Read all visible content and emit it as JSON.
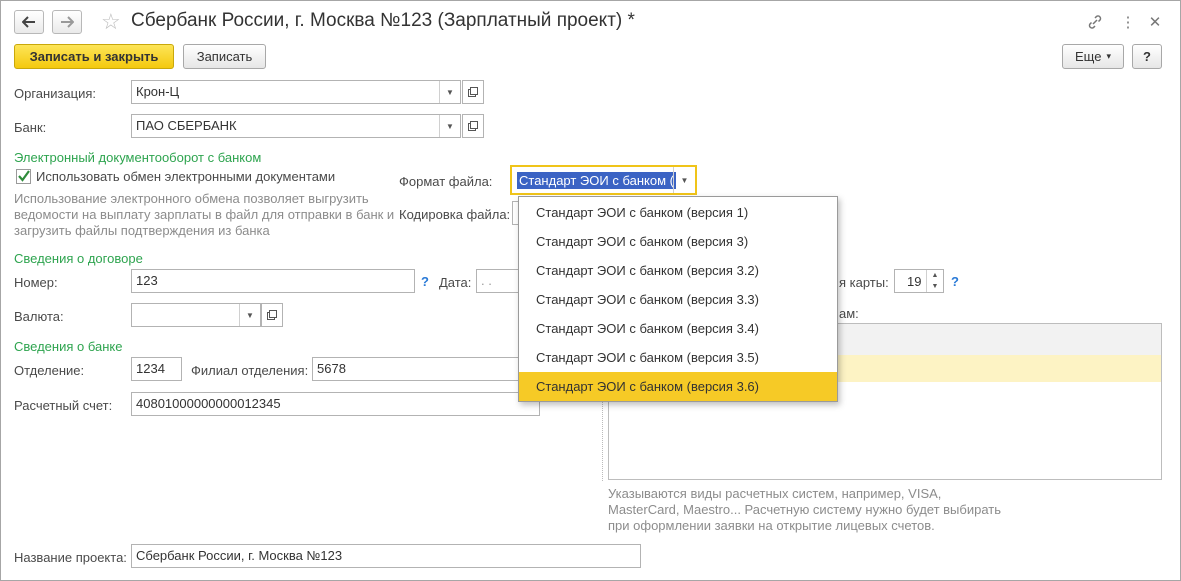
{
  "window": {
    "title": "Сбербанк России, г. Москва №123 (Зарплатный проект) *"
  },
  "toolbar": {
    "save_close": "Записать и закрыть",
    "save": "Записать",
    "more": "Еще",
    "more_arrow": "▾",
    "help": "?"
  },
  "org": {
    "label": "Организация:",
    "value": "Крон-Ц"
  },
  "bank": {
    "label": "Банк:",
    "value": "ПАО СБЕРБАНК"
  },
  "edo": {
    "section": "Электронный документооборот с банком",
    "checkbox_label": "Использовать обмен электронными документами",
    "hint1": "Использование электронного обмена позволяет выгрузить",
    "hint2": "ведомости на выплату зарплаты в файл для отправки в банк и",
    "hint3": "загрузить файлы подтверждения из банка",
    "format_label": "Формат файла:",
    "format_value": "Стандарт ЭОИ с банком (",
    "encoding_label": "Кодировка файла:"
  },
  "dropdown": {
    "options": [
      "Стандарт ЭОИ с банком (версия 1)",
      "Стандарт ЭОИ с банком (версия 3)",
      "Стандарт ЭОИ с банком (версия 3.2)",
      "Стандарт ЭОИ с банком (версия 3.3)",
      "Стандарт ЭОИ с банком (версия 3.4)",
      "Стандарт ЭОИ с банком (версия 3.5)",
      "Стандарт ЭОИ с банком (версия 3.6)"
    ],
    "selected": "Стандарт ЭОИ с банком (версия 3.6)"
  },
  "contract": {
    "section": "Сведения о договоре",
    "number_label": "Номер:",
    "number_value": "123",
    "date_label": "Дата:",
    "date_value": ". .",
    "currency_label": "Валюта:",
    "currency_value": "",
    "help_mark": "?"
  },
  "card": {
    "label_partial": "я карты:",
    "value": "19",
    "help_mark": "?",
    "table_label_partial": "ам:"
  },
  "bankinfo": {
    "section": "Сведения о банке",
    "branch_label": "Отделение:",
    "branch_value": "1234",
    "subbranch_label": "Филиал отделения:",
    "subbranch_value": "5678",
    "account_label": "Расчетный счет:",
    "account_value": "40801000000000012345"
  },
  "payment_hint": {
    "line1": "Указываются виды расчетных систем, например, VISA,",
    "line2": "MasterCard, Maestro... Расчетную систему нужно будет выбирать",
    "line3": "при оформлении заявки на открытие лицевых счетов."
  },
  "project": {
    "label": "Название проекта:",
    "value": "Сбербанк России, г. Москва №123"
  },
  "colors": {
    "accent_yellow": "#f6ca26",
    "section_green": "#2ea44f",
    "focus_border": "#f0c419",
    "selection_blue": "#3b63c4"
  },
  "icons": [
    "back-arrow-icon",
    "forward-arrow-icon",
    "star-icon",
    "link-icon",
    "more-vertical-icon",
    "close-icon",
    "open-form-icon",
    "dropdown-arrow-icon",
    "checkmark-icon"
  ]
}
